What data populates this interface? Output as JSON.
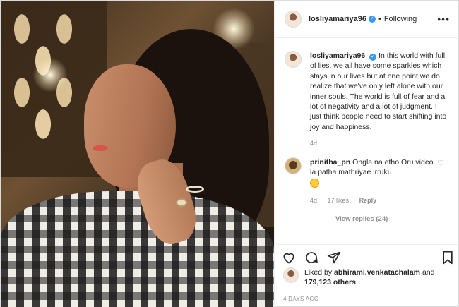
{
  "post": {
    "username": "losliyamariya96",
    "follow_status": "Following",
    "more_label": "•••",
    "caption": "In this world with full of lies, we all have some sparkles which stays in our lives but at one point we do realize that we've only left alone with our inner souls. The world is full of fear and a lot of negativity and a lot of judgment. I just think people need to start shifting into joy and happiness.",
    "caption_age": "4d"
  },
  "comment": {
    "username": "prinitha_pn",
    "text": "Ongla na etho Oru video la patha mathriyae irruku",
    "age": "4d",
    "likes": "17 likes",
    "reply_label": "Reply",
    "view_replies": "View replies (24)"
  },
  "actions": {
    "icons": [
      "heart-icon",
      "comment-icon",
      "share-icon",
      "bookmark-icon"
    ]
  },
  "likes": {
    "prefix": "Liked by",
    "liker": "abhirami.venkatachalam",
    "connector": "and",
    "others": "179,123 others"
  },
  "timestamp": "4 DAYS AGO",
  "colors": {
    "verified": "#3897f0",
    "muted": "#8e8e8e",
    "text": "#262626",
    "border": "#dbdbdb"
  }
}
